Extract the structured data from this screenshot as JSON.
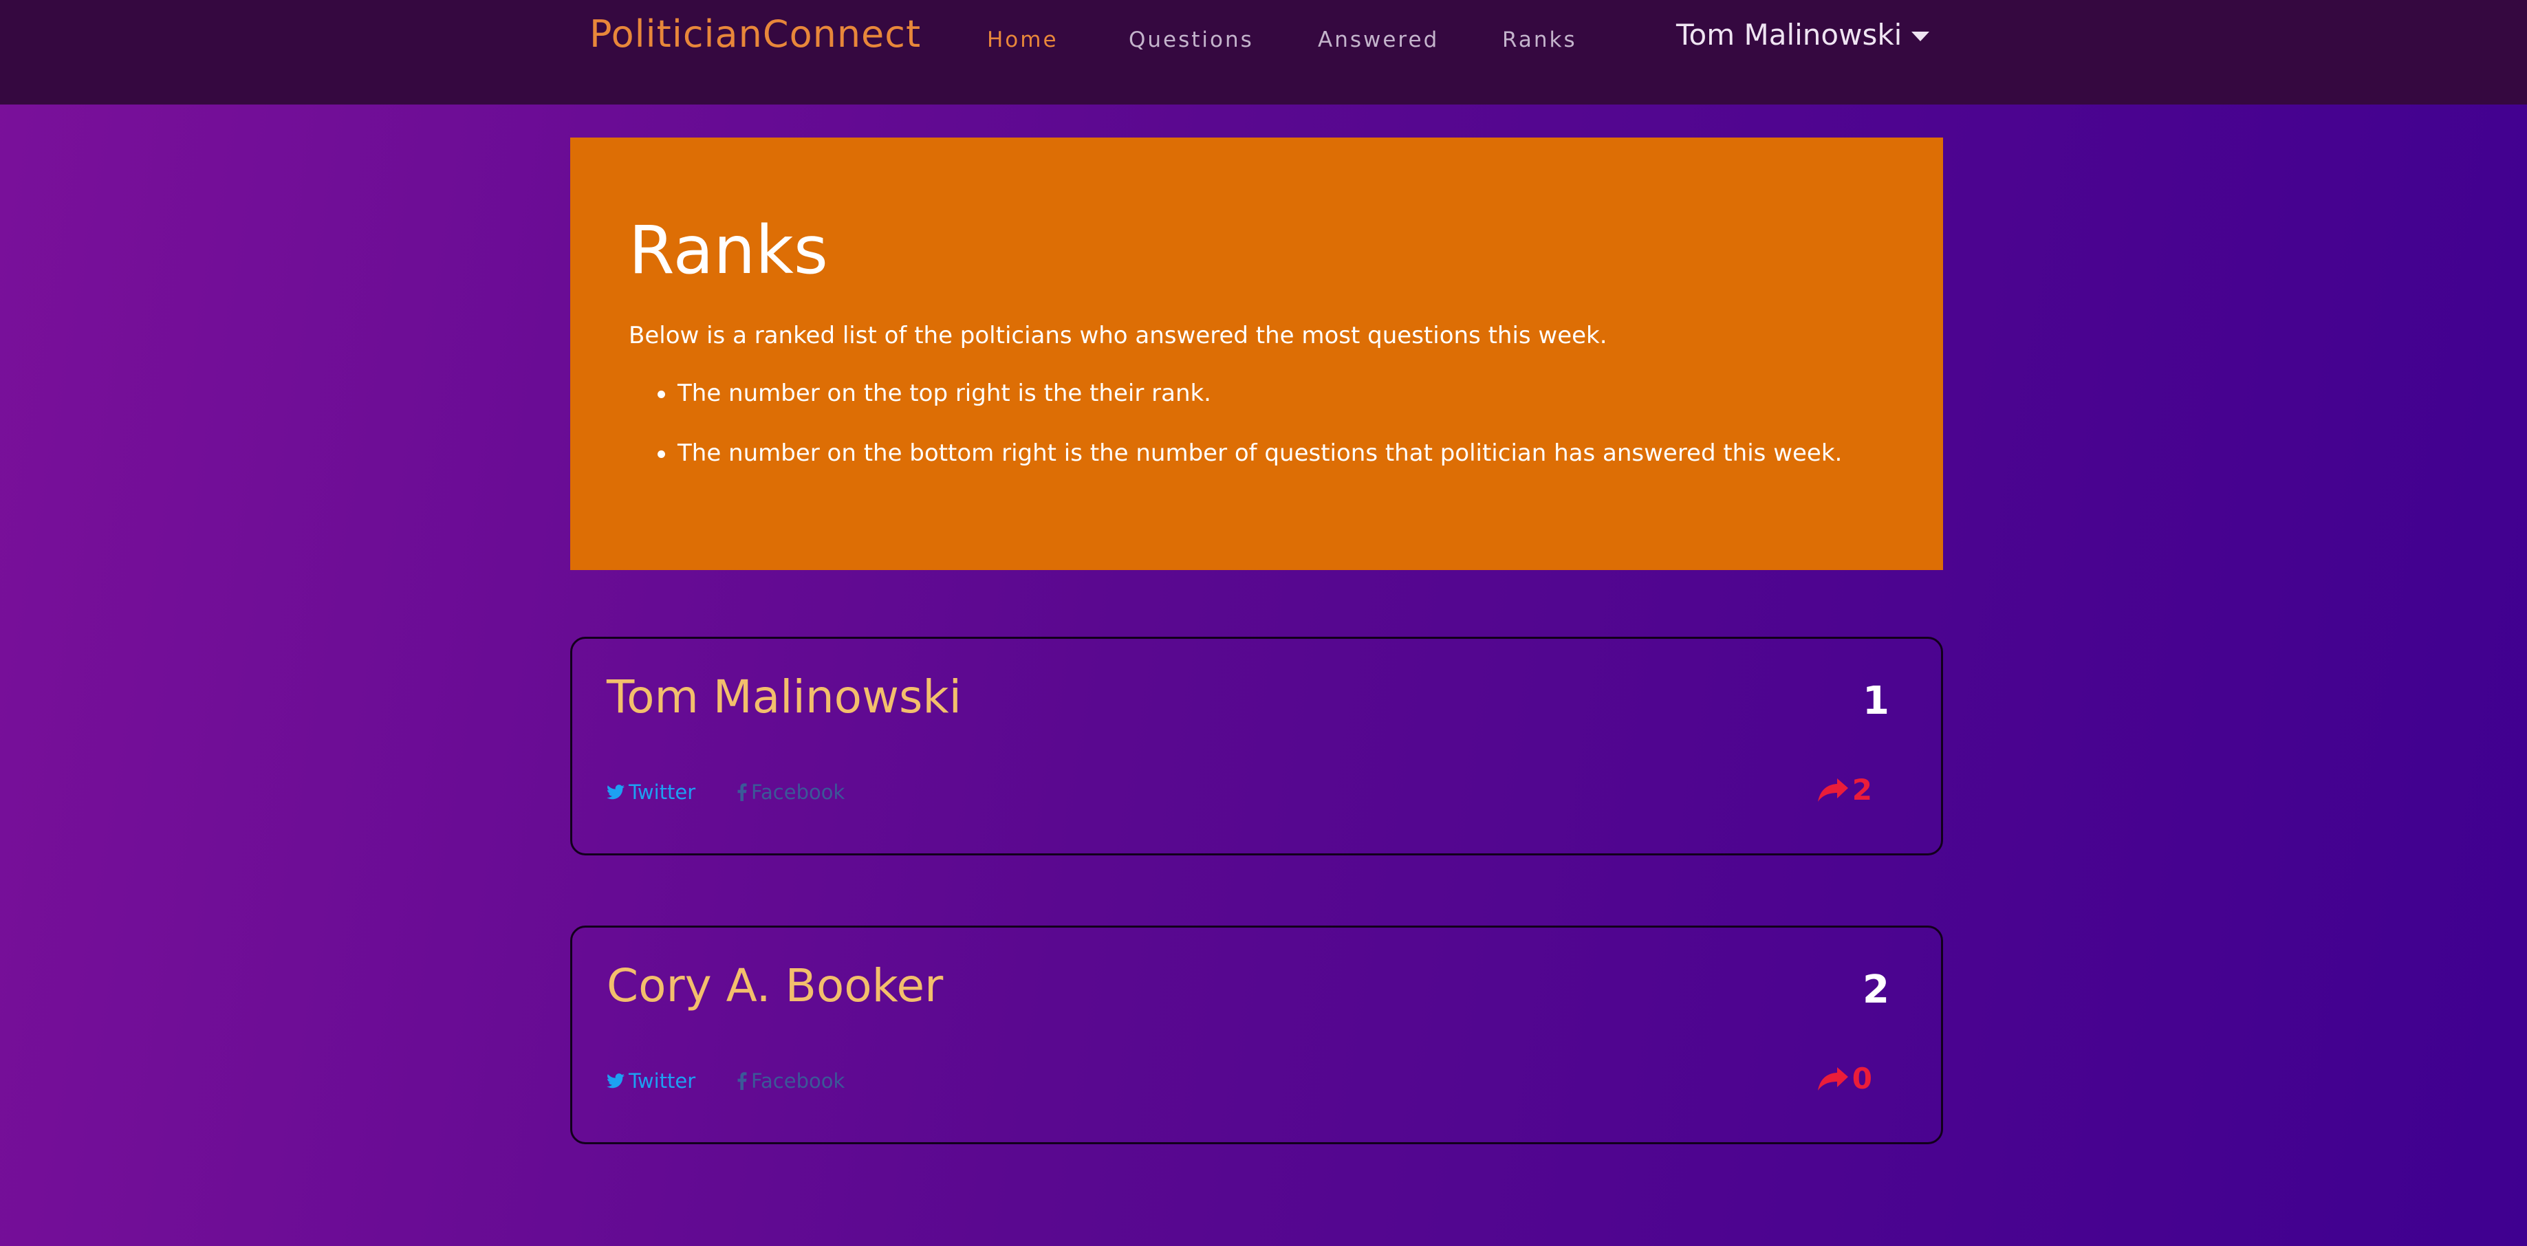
{
  "navbar": {
    "brand": "PoliticianConnect",
    "links": [
      {
        "label": "Home",
        "active": true
      },
      {
        "label": "Questions",
        "active": false
      },
      {
        "label": "Answered",
        "active": false
      },
      {
        "label": "Ranks",
        "active": false
      }
    ],
    "user": "Tom Malinowski"
  },
  "jumbotron": {
    "title": "Ranks",
    "lead": "Below is a ranked list of the polticians who answered the most questions this week.",
    "bullets": [
      "The number on the top right is the their rank.",
      "The number on the bottom right is the number of questions that politician has answered this week."
    ]
  },
  "ranks": [
    {
      "name": "Tom Malinowski",
      "rank": "1",
      "twitter": "Twitter",
      "facebook": "Facebook",
      "answered": "2"
    },
    {
      "name": "Cory A. Booker",
      "rank": "2",
      "twitter": "Twitter",
      "facebook": "Facebook",
      "answered": "0"
    }
  ],
  "icons": {
    "twitter": "twitter-icon",
    "facebook": "facebook-icon",
    "answered": "share-arrow-icon",
    "user_menu": "caret-down-icon"
  },
  "colors": {
    "navbar_bg": "#350840",
    "brand": "#e8873a",
    "jumbotron_bg": "#dd6e05",
    "card_name": "#f3bf6c",
    "twitter": "#1da1f2",
    "facebook": "#3b5998",
    "answered": "#ea1d3a"
  }
}
